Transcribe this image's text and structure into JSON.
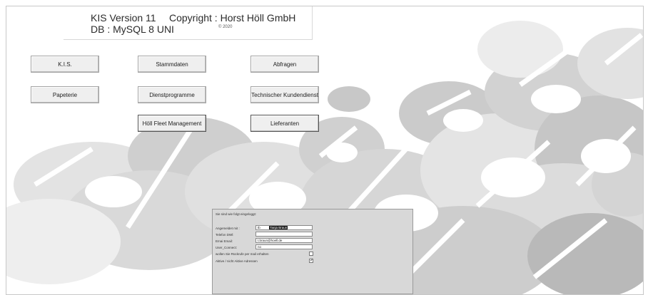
{
  "header": {
    "version": "KIS Version 11",
    "copyright": "Copyright : Horst Höll GmbH",
    "db": "DB : MySQL 8 UNI",
    "year": "© 2020"
  },
  "buttons": {
    "kis": "K.I.S.",
    "stammdaten": "Stammdaten",
    "abfragen": "Abfragen",
    "papeterie": "Papeterie",
    "dienstprogramme": "Dienstprogramme",
    "technischer": "Technischer Kundendienst",
    "fleet": "Höll Fleet Management",
    "lieferanten": "Lieferanten"
  },
  "login_panel": {
    "title": "Sie sind wie folgt eingeloggt:",
    "fields": [
      {
        "label": "Angemeldet mit :",
        "value_prefix": "tb",
        "value_selected": "Tanja Braun"
      },
      {
        "label": "Telefon DWl:",
        "value": ""
      },
      {
        "label": "Emai Email:",
        "value": "t.braun@hoell.de"
      },
      {
        "label": "User_Connect:",
        "value": "no"
      }
    ],
    "checks": [
      {
        "label": "wollen Sie Rückrufe per mail erhalten",
        "checked": false
      },
      {
        "label": "Aktive / nicht Aktive Adressen",
        "checked": true
      }
    ]
  },
  "colors": {
    "background": "#ffffff",
    "art_light": "#e6e6e6",
    "art_mid": "#c9c9c9",
    "art_dark": "#b0b0b0",
    "panel": "#d8d8d8"
  }
}
